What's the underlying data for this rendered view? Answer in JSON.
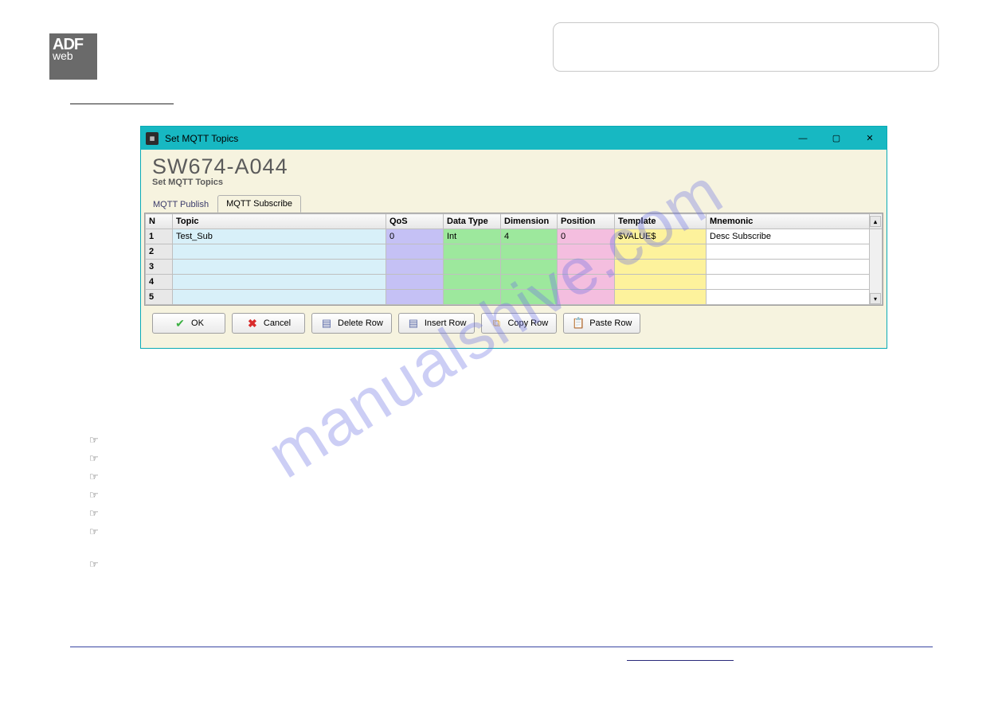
{
  "window": {
    "title": "Set MQTT Topics",
    "header_title": "SW674-A044",
    "header_sub": "Set MQTT Topics",
    "tabs": [
      {
        "label": "MQTT Publish",
        "active": false
      },
      {
        "label": "MQTT Subscribe",
        "active": true
      }
    ],
    "columns": [
      "N",
      "Topic",
      "QoS",
      "Data Type",
      "Dimension",
      "Position",
      "Template",
      "Mnemonic"
    ],
    "rows": [
      {
        "n": "1",
        "topic": "Test_Sub",
        "qos": "0",
        "datatype": "Int",
        "dimension": "4",
        "position": "0",
        "template": "$VALUE$",
        "mnemonic": "Desc Subscribe"
      },
      {
        "n": "2",
        "topic": "",
        "qos": "",
        "datatype": "",
        "dimension": "",
        "position": "",
        "template": "",
        "mnemonic": ""
      },
      {
        "n": "3",
        "topic": "",
        "qos": "",
        "datatype": "",
        "dimension": "",
        "position": "",
        "template": "",
        "mnemonic": ""
      },
      {
        "n": "4",
        "topic": "",
        "qos": "",
        "datatype": "",
        "dimension": "",
        "position": "",
        "template": "",
        "mnemonic": ""
      },
      {
        "n": "5",
        "topic": "",
        "qos": "",
        "datatype": "",
        "dimension": "",
        "position": "",
        "template": "",
        "mnemonic": ""
      }
    ],
    "buttons": {
      "ok": "OK",
      "cancel": "Cancel",
      "delete": "Delete Row",
      "insert": "Insert Row",
      "copy": "Copy Row",
      "paste": "Paste Row"
    }
  },
  "logo": {
    "top": "ADF",
    "bot": "web"
  },
  "watermark": "manualshive.com"
}
